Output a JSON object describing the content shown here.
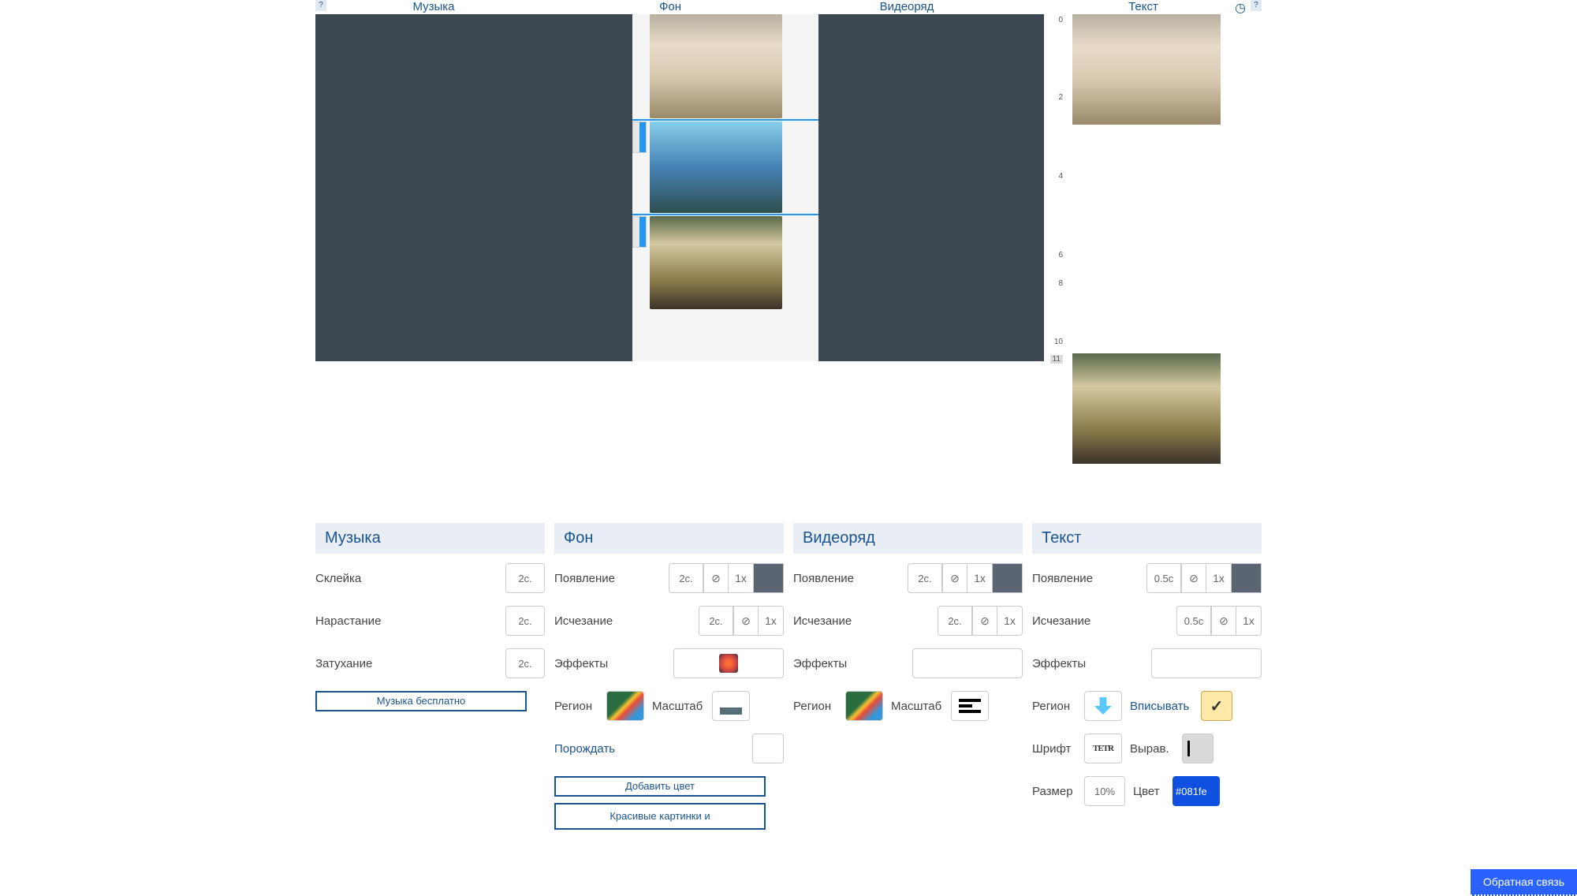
{
  "help": "?",
  "tabs": {
    "music": "Музыка",
    "bg": "Фон",
    "video": "Видеоряд",
    "text": "Текст"
  },
  "ruler": [
    "0",
    "2",
    "4",
    "6",
    "8",
    "10",
    "11"
  ],
  "panels": {
    "music": {
      "title": "Музыка",
      "splice": {
        "label": "Склейка",
        "val": "2с."
      },
      "rise": {
        "label": "Нарастание",
        "val": "2с."
      },
      "fade": {
        "label": "Затухание",
        "val": "2с."
      },
      "free": "Музыка бесплатно"
    },
    "bg": {
      "title": "Фон",
      "appear": {
        "label": "Появление",
        "dur": "2с.",
        "mult": "1x"
      },
      "disappear": {
        "label": "Исчезание",
        "dur": "2с.",
        "mult": "1x"
      },
      "effects": "Эффекты",
      "region": "Регион",
      "scale": "Масштаб",
      "spawn": "Порождать",
      "addcolor": "Добавить цвет",
      "pics": "Красивые картинки и"
    },
    "video": {
      "title": "Видеоряд",
      "appear": {
        "label": "Появление",
        "dur": "2с.",
        "mult": "1x"
      },
      "disappear": {
        "label": "Исчезание",
        "dur": "2с.",
        "mult": "1x"
      },
      "effects": "Эффекты",
      "region": "Регион",
      "scale": "Масштаб"
    },
    "text": {
      "title": "Текст",
      "appear": {
        "label": "Появление",
        "dur": "0.5с",
        "mult": "1x"
      },
      "disappear": {
        "label": "Исчезание",
        "dur": "0.5с",
        "mult": "1x"
      },
      "effects": "Эффекты",
      "region": "Регион",
      "fit": "Вписывать",
      "font": {
        "label": "Шрифт",
        "sample": "TETR"
      },
      "align": "Вырав.",
      "size": {
        "label": "Размер",
        "val": "10%"
      },
      "color": {
        "label": "Цвет",
        "val": "#081fe"
      }
    }
  },
  "feedback": "Обратная связь",
  "icons": {
    "no": "⊘",
    "check": "✓"
  }
}
